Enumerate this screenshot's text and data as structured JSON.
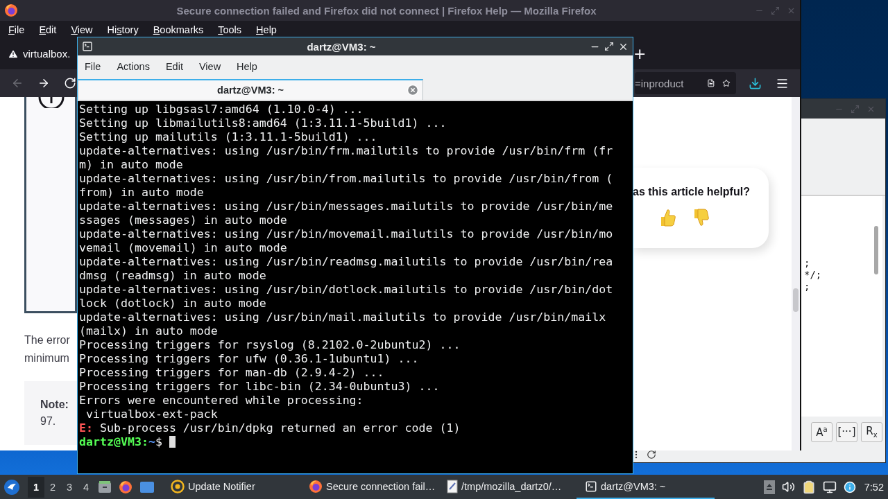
{
  "firefox": {
    "title": "Secure connection failed and Firefox did not connect | Firefox Help — Mozilla Firefox",
    "menu": [
      {
        "key": "F",
        "post": "ile"
      },
      {
        "key": "E",
        "post": "dit"
      },
      {
        "key": "V",
        "post": "iew"
      },
      {
        "pre": "Hi",
        "key": "s",
        "post": "tory"
      },
      {
        "key": "B",
        "post": "ookmarks"
      },
      {
        "key": "T",
        "post": "ools"
      },
      {
        "key": "H",
        "post": "elp"
      }
    ],
    "tab": {
      "label": "virtualbox."
    },
    "new_tab": "+",
    "nav": {
      "back_disabled": true,
      "forward_disabled": false
    },
    "url": "=inproduct",
    "page": {
      "intro_lines": [
        "The error",
        "minimum"
      ],
      "note_lines": [
        "**Note:**",
        "97."
      ],
      "feedback": {
        "question": "as this article helpful?"
      }
    }
  },
  "terminal": {
    "title": "dartz@VM3: ~",
    "menu": [
      "File",
      "Actions",
      "Edit",
      "View",
      "Help"
    ],
    "tab": {
      "label": "dartz@VM3: ~"
    },
    "lines": [
      {
        "kind": "output",
        "text": "Setting up libgsasl7:amd64 (1.10.0-4) ..."
      },
      {
        "kind": "output",
        "text": "Setting up libmailutils8:amd64 (1:3.11.1-5build1) ..."
      },
      {
        "kind": "output",
        "text": "Setting up mailutils (1:3.11.1-5build1) ..."
      },
      {
        "kind": "output",
        "text": "update-alternatives: using /usr/bin/frm.mailutils to provide /usr/bin/frm (fr"
      },
      {
        "kind": "output",
        "text": "m) in auto mode"
      },
      {
        "kind": "output",
        "text": "update-alternatives: using /usr/bin/from.mailutils to provide /usr/bin/from ("
      },
      {
        "kind": "output",
        "text": "from) in auto mode"
      },
      {
        "kind": "output",
        "text": "update-alternatives: using /usr/bin/messages.mailutils to provide /usr/bin/me"
      },
      {
        "kind": "output",
        "text": "ssages (messages) in auto mode"
      },
      {
        "kind": "output",
        "text": "update-alternatives: using /usr/bin/movemail.mailutils to provide /usr/bin/mo"
      },
      {
        "kind": "output",
        "text": "vemail (movemail) in auto mode"
      },
      {
        "kind": "output",
        "text": "update-alternatives: using /usr/bin/readmsg.mailutils to provide /usr/bin/rea"
      },
      {
        "kind": "output",
        "text": "dmsg (readmsg) in auto mode"
      },
      {
        "kind": "output",
        "text": "update-alternatives: using /usr/bin/dotlock.mailutils to provide /usr/bin/dot"
      },
      {
        "kind": "output",
        "text": "lock (dotlock) in auto mode"
      },
      {
        "kind": "output",
        "text": "update-alternatives: using /usr/bin/mail.mailutils to provide /usr/bin/mailx"
      },
      {
        "kind": "output",
        "text": "(mailx) in auto mode"
      },
      {
        "kind": "output",
        "text": "Processing triggers for rsyslog (8.2102.0-2ubuntu2) ..."
      },
      {
        "kind": "output",
        "text": "Processing triggers for ufw (0.36.1-1ubuntu1) ..."
      },
      {
        "kind": "output",
        "text": "Processing triggers for man-db (2.9.4-2) ..."
      },
      {
        "kind": "output",
        "text": "Processing triggers for libc-bin (2.34-0ubuntu3) ..."
      },
      {
        "kind": "output",
        "text": "Errors were encountered while processing:"
      },
      {
        "kind": "output",
        "text": " virtualbox-ext-pack"
      },
      {
        "kind": "error",
        "label": "E:",
        "text": " Sub-process /usr/bin/dpkg returned an error code (1)"
      },
      {
        "kind": "prompt",
        "host": "dartz@VM3:",
        "path": "~",
        "symbol": "$ "
      }
    ]
  },
  "editor": {
    "code_lines": [
      ";",
      "*/;",
      ";"
    ],
    "tool_buttons": [
      "A$^{a}$",
      "[···]",
      "R$_{x}$"
    ]
  },
  "taskbar": {
    "workspaces": [
      {
        "label": "1",
        "selected": true
      },
      {
        "label": "2",
        "selected": false
      },
      {
        "label": "3",
        "selected": false
      },
      {
        "label": "4",
        "selected": false
      }
    ],
    "tasks": [
      {
        "kind": "notifier",
        "label": "Update Notifier",
        "selected": false
      },
      {
        "kind": "browser",
        "label": "Secure connection fail…",
        "selected": false
      },
      {
        "kind": "document",
        "label": "/tmp/mozilla_dartz0/…",
        "selected": false
      },
      {
        "kind": "terminal",
        "label": "dartz@VM3: ~",
        "selected": true
      }
    ],
    "clock": "7:52"
  }
}
